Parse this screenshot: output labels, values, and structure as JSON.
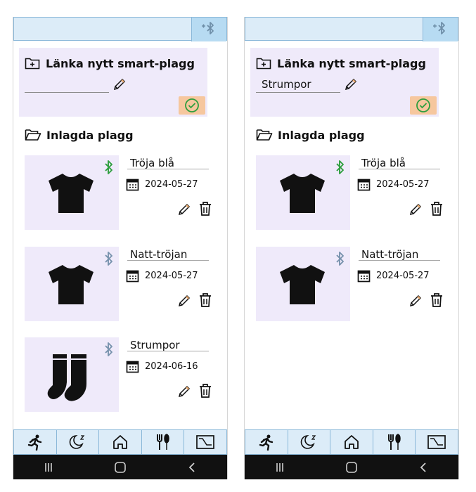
{
  "screens": [
    {
      "link": {
        "title": "Länka nytt smart-plagg",
        "name_value": "",
        "name_placeholder": ""
      },
      "section_title": "Inlagda plagg",
      "items": [
        {
          "name": "Tröja blå",
          "date": "2024-05-27",
          "icon": "tshirt-icon",
          "bt_status": "connected",
          "bt_color": "#2e9e3e"
        },
        {
          "name": "Natt-tröjan",
          "date": "2024-05-27",
          "icon": "tshirt-icon",
          "bt_status": "disconnected",
          "bt_color": "#7893ad"
        },
        {
          "name": "Strumpor",
          "date": "2024-06-16",
          "icon": "socks-icon",
          "bt_status": "disconnected",
          "bt_color": "#7893ad"
        }
      ]
    },
    {
      "link": {
        "title": "Länka nytt smart-plagg",
        "name_value": "Strumpor",
        "name_placeholder": ""
      },
      "section_title": "Inlagda plagg",
      "items": [
        {
          "name": "Tröja blå",
          "date": "2024-05-27",
          "icon": "tshirt-icon",
          "bt_status": "connected",
          "bt_color": "#2e9e3e"
        },
        {
          "name": "Natt-tröjan",
          "date": "2024-05-27",
          "icon": "tshirt-icon",
          "bt_status": "disconnected",
          "bt_color": "#7893ad"
        }
      ]
    }
  ],
  "nav": [
    "activity-icon",
    "sleep-icon",
    "home-icon",
    "food-icon",
    "chart-icon"
  ],
  "colors": {
    "accent_bar": "#dcecf8",
    "card_bg": "#efeafa",
    "confirm_bg": "#f6c79e",
    "confirm_check": "#2e9e3e"
  }
}
